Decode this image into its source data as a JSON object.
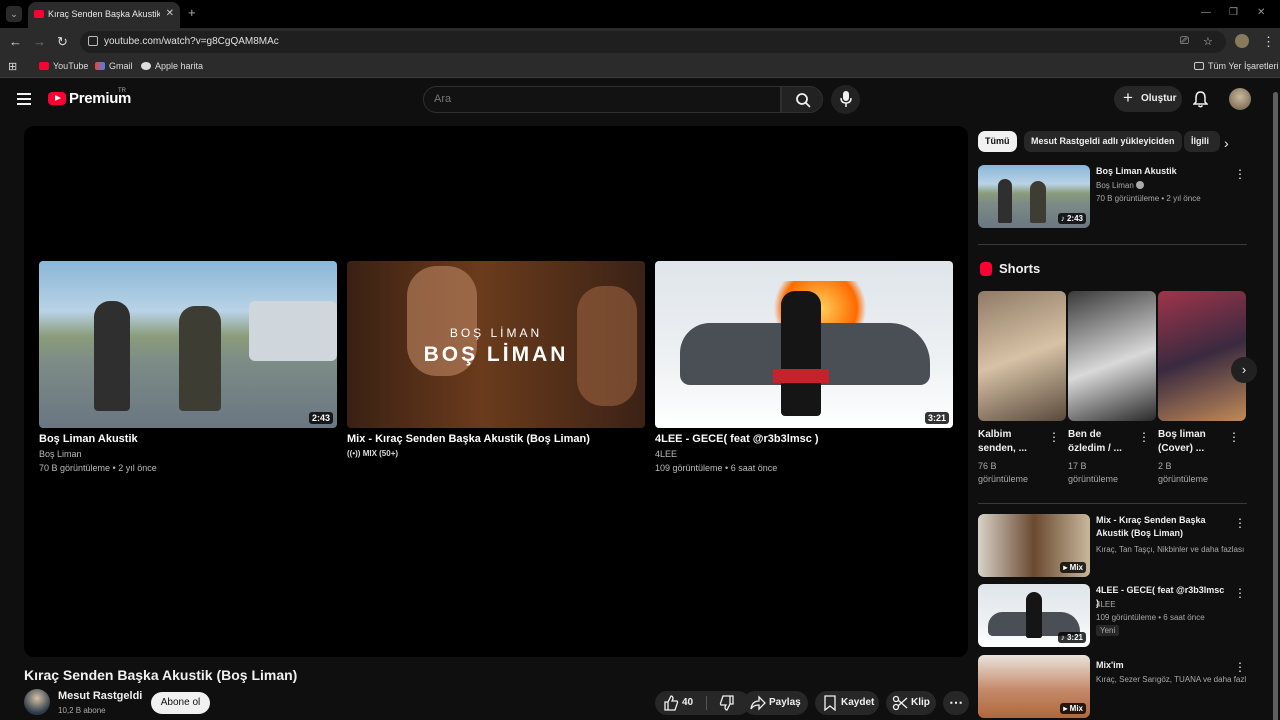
{
  "browser": {
    "tab_title": "Kıraç Senden Başka Akustik (Boş",
    "url": "youtube.com/watch?v=g8CgQAM8MAc",
    "bookmarks": [
      "YouTube",
      "Gmail",
      "Apple harita"
    ],
    "all_bookmarks": "Tüm Yer İşaretleri"
  },
  "header": {
    "logo": "Premium",
    "country": "TR",
    "search_placeholder": "Ara",
    "create_label": "Oluştur"
  },
  "endscreen": [
    {
      "title": "Boş Liman Akustik",
      "channel": "Boş Liman",
      "meta": "70 B görüntüleme • 2 yıl önce",
      "duration": "2:43"
    },
    {
      "title": "Mix - Kıraç Senden Başka Akustik (Boş Liman)",
      "channel": "MIX (50+)",
      "meta": "",
      "duration": "",
      "overlay_top": "BOŞ LİMAN",
      "overlay_main": "BOŞ LİMAN"
    },
    {
      "title": "4LEE - GECE( feat @r3b3lmsc )",
      "channel": "4LEE",
      "meta": "109 görüntüleme • 6 saat önce",
      "duration": "3:21"
    }
  ],
  "video": {
    "title": "Kıraç Senden Başka Akustik (Boş Liman)",
    "channel": "Mesut Rastgeldi",
    "subscribers": "10,2 B abone",
    "subscribe_label": "Abone ol",
    "likes": "40",
    "share_label": "Paylaş",
    "save_label": "Kaydet",
    "clip_label": "Klip"
  },
  "sidebar": {
    "chips": [
      "Tümü",
      "Mesut Rastgeldi adlı yükleyiciden",
      "İlgili"
    ],
    "top_rec": {
      "title": "Boş Liman Akustik",
      "channel": "Boş Liman",
      "meta": "70 B görüntüleme • 2 yıl önce",
      "duration": "2:43"
    },
    "shorts_title": "Shorts",
    "shorts": [
      {
        "title": "Kalbim senden, ...",
        "views": "76 B görüntüleme"
      },
      {
        "title": "Ben de özledim / ...",
        "views": "17 B görüntüleme"
      },
      {
        "title": "Boş liman (Cover) ...",
        "views": "2 B görüntüleme"
      }
    ],
    "recs": [
      {
        "title": "Mix - Kıraç Senden Başka Akustik (Boş Liman)",
        "channel": "Kıraç, Tan Taşçı, Nikbinler ve daha fazlası",
        "meta": "",
        "badge": "Mix"
      },
      {
        "title": "4LEE - GECE( feat @r3b3lmsc )",
        "channel": "4LEE",
        "meta": "109 görüntüleme • 6 saat önce",
        "badge": "3:21",
        "new": "Yeni"
      },
      {
        "title": "Mix'im",
        "channel": "Kıraç, Sezer Sarıgöz, TUANA ve daha fazl...",
        "meta": "",
        "badge": "Mix"
      }
    ]
  },
  "colors": {
    "background": "#0f0f0f",
    "brand_red": "#ff0033",
    "text": "#f1f1f1",
    "secondary_text": "#aaaaaa"
  }
}
